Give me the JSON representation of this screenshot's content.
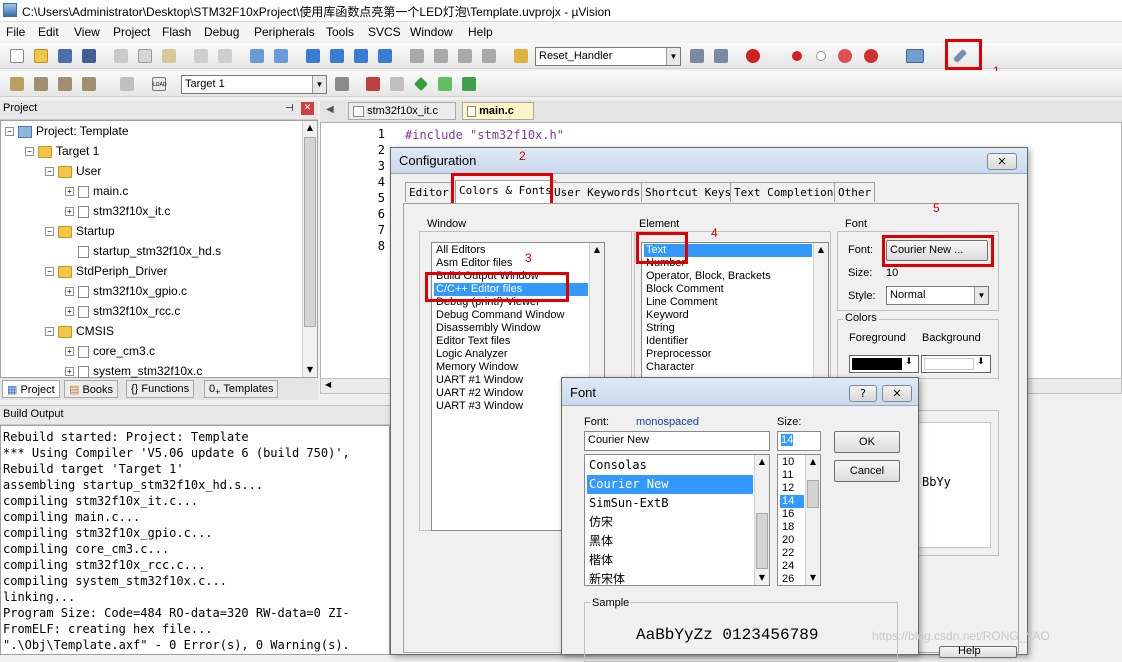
{
  "window": {
    "title": "C:\\Users\\Administrator\\Desktop\\STM32F10xProject\\使用库函数点亮第一个LED灯泡\\Template.uvprojx - µVision"
  },
  "menu": [
    "File",
    "Edit",
    "View",
    "Project",
    "Flash",
    "Debug",
    "Peripherals",
    "Tools",
    "SVCS",
    "Window",
    "Help"
  ],
  "toolbar": {
    "function_combo": "Reset_Handler",
    "target_combo": "Target 1",
    "load_label": "LOAD"
  },
  "annotations": [
    "1",
    "2",
    "3",
    "4",
    "5"
  ],
  "project_panel": {
    "header": "Project",
    "tree": [
      {
        "label": "Project: Template",
        "level": 0,
        "icon": "project-icon",
        "exp": "−"
      },
      {
        "label": "Target 1",
        "level": 1,
        "icon": "folder-icon",
        "exp": "−"
      },
      {
        "label": "User",
        "level": 2,
        "icon": "folder-icon",
        "exp": "−"
      },
      {
        "label": "main.c",
        "level": 3,
        "icon": "file-icon",
        "exp": "+"
      },
      {
        "label": "stm32f10x_it.c",
        "level": 3,
        "icon": "file-icon",
        "exp": "+"
      },
      {
        "label": "Startup",
        "level": 2,
        "icon": "folder-icon",
        "exp": "−"
      },
      {
        "label": "startup_stm32f10x_hd.s",
        "level": 3,
        "icon": "file-icon",
        "exp": ""
      },
      {
        "label": "StdPeriph_Driver",
        "level": 2,
        "icon": "folder-icon",
        "exp": "−"
      },
      {
        "label": "stm32f10x_gpio.c",
        "level": 3,
        "icon": "file-icon",
        "exp": "+"
      },
      {
        "label": "stm32f10x_rcc.c",
        "level": 3,
        "icon": "file-icon",
        "exp": "+"
      },
      {
        "label": "CMSIS",
        "level": 2,
        "icon": "folder-icon",
        "exp": "−"
      },
      {
        "label": "core_cm3.c",
        "level": 3,
        "icon": "file-icon",
        "exp": "+"
      },
      {
        "label": "system_stm32f10x.c",
        "level": 3,
        "icon": "file-icon",
        "exp": "+"
      }
    ],
    "bottom_tabs": [
      "Project",
      "Books",
      "Functions",
      "Templates"
    ]
  },
  "editor": {
    "tabs": [
      "stm32f10x_it.c",
      "main.c"
    ],
    "line_numbers": [
      "1",
      "2",
      "3",
      "4",
      "5",
      "6",
      "7",
      "8"
    ],
    "code_line1": "#include \"stm32f10x.h\""
  },
  "build_output": {
    "header": "Build Output",
    "lines": [
      "Rebuild started: Project: Template",
      "*** Using Compiler 'V5.06 update 6 (build 750)',",
      "Rebuild target 'Target 1'",
      "assembling startup_stm32f10x_hd.s...",
      "compiling stm32f10x_it.c...",
      "compiling main.c...",
      "compiling stm32f10x_gpio.c...",
      "compiling core_cm3.c...",
      "compiling stm32f10x_rcc.c...",
      "compiling system_stm32f10x.c...",
      "linking...",
      "Program Size: Code=484 RO-data=320 RW-data=0 ZI-",
      "FromELF: creating hex file...",
      "\".\\Obj\\Template.axf\" - 0 Error(s), 0 Warning(s)."
    ]
  },
  "config_dialog": {
    "title": "Configuration",
    "close": "✕",
    "tabs": [
      "Editor",
      "Colors & Fonts",
      "User Keywords",
      "Shortcut Keys",
      "Text Completion",
      "Other"
    ],
    "window_group": "Window",
    "window_items": [
      "All Editors",
      "Asm Editor files",
      "Build Output Window",
      "C/C++ Editor files",
      "Debug (printf) Viewer",
      "Debug Command Window",
      "Disassembly Window",
      "Editor Text files",
      "Logic Analyzer",
      "Memory Window",
      "UART #1 Window",
      "UART #2 Window",
      "UART #3 Window"
    ],
    "element_group": "Element",
    "element_items": [
      "Text",
      "Number",
      "Operator, Block, Brackets",
      "Block Comment",
      "Line Comment",
      "Keyword",
      "String",
      "Identifier",
      "Preprocessor",
      "Character"
    ],
    "font_group": "Font",
    "font_label": "Font:",
    "font_button": "Courier New ...",
    "size_label": "Size:",
    "size_value": "10",
    "style_label": "Style:",
    "style_value": "Normal",
    "colors_group": "Colors",
    "foreground_label": "Foreground",
    "background_label": "Background",
    "preview_text": "BbYy",
    "help_button": "Help",
    "colors": {
      "foreground": "#000000",
      "background": "#ffffff"
    }
  },
  "font_dialog": {
    "title": "Font",
    "help_q": "?",
    "close": "✕",
    "font_label": "Font:",
    "font_type": "monospaced",
    "font_value": "Courier New",
    "font_items": [
      "Consolas",
      "Courier New",
      "SimSun-ExtB",
      "仿宋",
      "黑体",
      "楷体",
      "新宋体"
    ],
    "size_label": "Size:",
    "size_value": "14",
    "size_items": [
      "10",
      "11",
      "12",
      "14",
      "16",
      "18",
      "20",
      "22",
      "24",
      "26"
    ],
    "ok_button": "OK",
    "cancel_button": "Cancel",
    "sample_label": "Sample",
    "sample_text": "AaBbYyZz 0123456789"
  },
  "watermark": "https://blog.csdn.net/RONG_YAO"
}
